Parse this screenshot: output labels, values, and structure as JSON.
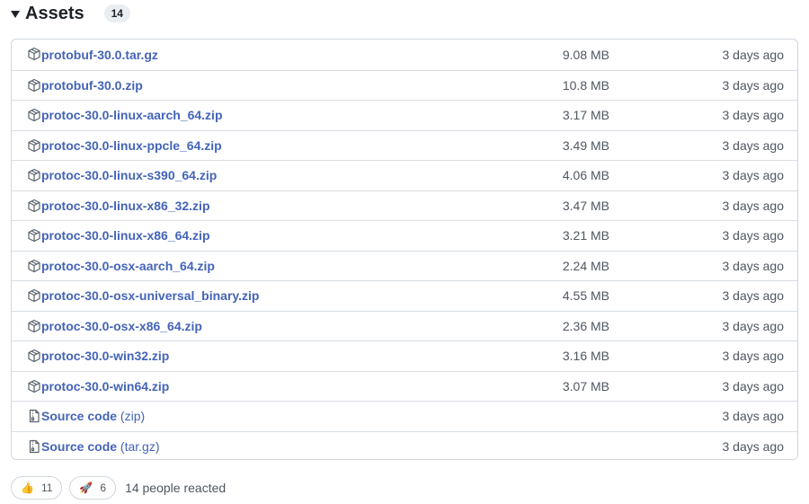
{
  "header": {
    "title": "Assets",
    "count": "14"
  },
  "assets": [
    {
      "name": "protobuf-30.0.tar.gz",
      "suffix": "",
      "icon": "package-icon",
      "size": "9.08 MB",
      "date": "3 days ago"
    },
    {
      "name": "protobuf-30.0.zip",
      "suffix": "",
      "icon": "package-icon",
      "size": "10.8 MB",
      "date": "3 days ago"
    },
    {
      "name": "protoc-30.0-linux-aarch_64.zip",
      "suffix": "",
      "icon": "package-icon",
      "size": "3.17 MB",
      "date": "3 days ago"
    },
    {
      "name": "protoc-30.0-linux-ppcle_64.zip",
      "suffix": "",
      "icon": "package-icon",
      "size": "3.49 MB",
      "date": "3 days ago"
    },
    {
      "name": "protoc-30.0-linux-s390_64.zip",
      "suffix": "",
      "icon": "package-icon",
      "size": "4.06 MB",
      "date": "3 days ago"
    },
    {
      "name": "protoc-30.0-linux-x86_32.zip",
      "suffix": "",
      "icon": "package-icon",
      "size": "3.47 MB",
      "date": "3 days ago"
    },
    {
      "name": "protoc-30.0-linux-x86_64.zip",
      "suffix": "",
      "icon": "package-icon",
      "size": "3.21 MB",
      "date": "3 days ago"
    },
    {
      "name": "protoc-30.0-osx-aarch_64.zip",
      "suffix": "",
      "icon": "package-icon",
      "size": "2.24 MB",
      "date": "3 days ago"
    },
    {
      "name": "protoc-30.0-osx-universal_binary.zip",
      "suffix": "",
      "icon": "package-icon",
      "size": "4.55 MB",
      "date": "3 days ago"
    },
    {
      "name": "protoc-30.0-osx-x86_64.zip",
      "suffix": "",
      "icon": "package-icon",
      "size": "2.36 MB",
      "date": "3 days ago"
    },
    {
      "name": "protoc-30.0-win32.zip",
      "suffix": "",
      "icon": "package-icon",
      "size": "3.16 MB",
      "date": "3 days ago"
    },
    {
      "name": "protoc-30.0-win64.zip",
      "suffix": "",
      "icon": "package-icon",
      "size": "3.07 MB",
      "date": "3 days ago"
    },
    {
      "name": "Source code",
      "suffix": " (zip)",
      "icon": "file-zip-icon",
      "size": "",
      "date": "3 days ago"
    },
    {
      "name": "Source code",
      "suffix": " (tar.gz)",
      "icon": "file-zip-icon",
      "size": "",
      "date": "3 days ago"
    }
  ],
  "reactions": {
    "items": [
      {
        "emoji": "👍",
        "icon": "thumbs-up-icon",
        "count": "11"
      },
      {
        "emoji": "🚀",
        "icon": "rocket-icon",
        "count": "6"
      }
    ],
    "summary": "14 people reacted"
  },
  "colors": {
    "link": "#4464b8",
    "muted": "#4f5660",
    "border": "#d0d7de"
  }
}
